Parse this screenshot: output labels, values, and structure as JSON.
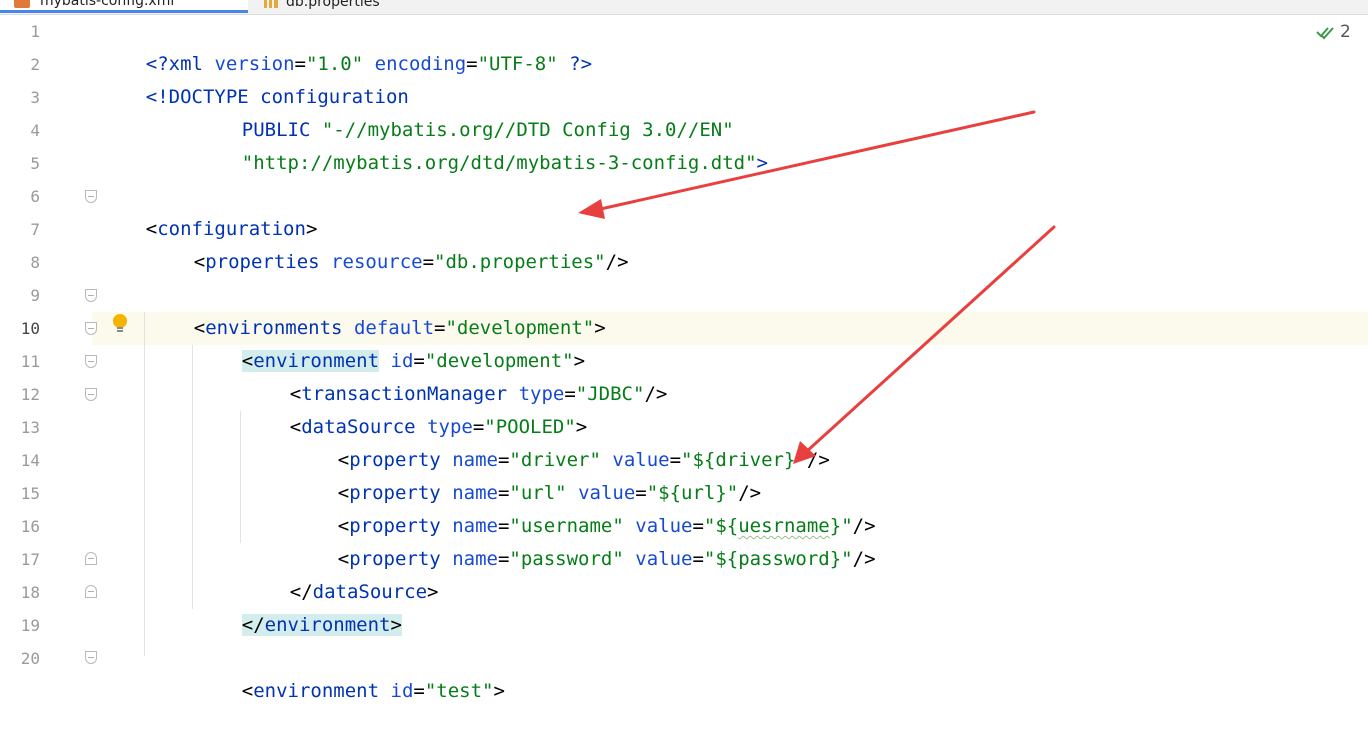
{
  "tabs": [
    {
      "label": "mybatis-config.xml",
      "icon": "xml-file-icon"
    },
    {
      "label": "db.properties",
      "icon": "properties-file-icon"
    }
  ],
  "inspection": {
    "count": "2",
    "icon": "check-double-icon"
  },
  "line_numbers": [
    "1",
    "2",
    "3",
    "4",
    "5",
    "6",
    "7",
    "8",
    "9",
    "10",
    "11",
    "12",
    "13",
    "14",
    "15",
    "16",
    "17",
    "18",
    "19",
    "20"
  ],
  "current_line": "10",
  "code_lines": [
    "<?xml version=\"1.0\" encoding=\"UTF-8\" ?>",
    "<!DOCTYPE configuration",
    "PUBLIC \"-//mybatis.org//DTD Config 3.0//EN\"",
    "\"http://mybatis.org/dtd/mybatis-3-config.dtd\">",
    "",
    "<configuration>",
    "<properties resource=\"db.properties\"/>",
    "",
    "<environments default=\"development\">",
    "<environment id=\"development\">",
    "<transactionManager type=\"JDBC\"/>",
    "<dataSource type=\"POOLED\">",
    "<property name=\"driver\" value=\"${driver}\"/>",
    "<property name=\"url\" value=\"${url}\"/>",
    "<property name=\"username\" value=\"${uesrname}\"/>",
    "<property name=\"password\" value=\"${password}\"/>",
    "</dataSource>",
    "</environment>",
    "",
    "<environment id=\"test\">"
  ],
  "colors": {
    "tag": "#0033b3",
    "attribute": "#174ad4",
    "value": "#067d17",
    "current_line_bg": "#fcfaed",
    "tag_highlight": "#d3ecec",
    "annotation_arrow": "#e8403f"
  },
  "annotations": [
    {
      "type": "arrow",
      "points_to": "db.properties"
    },
    {
      "type": "arrow",
      "points_to": "${url}"
    }
  ]
}
